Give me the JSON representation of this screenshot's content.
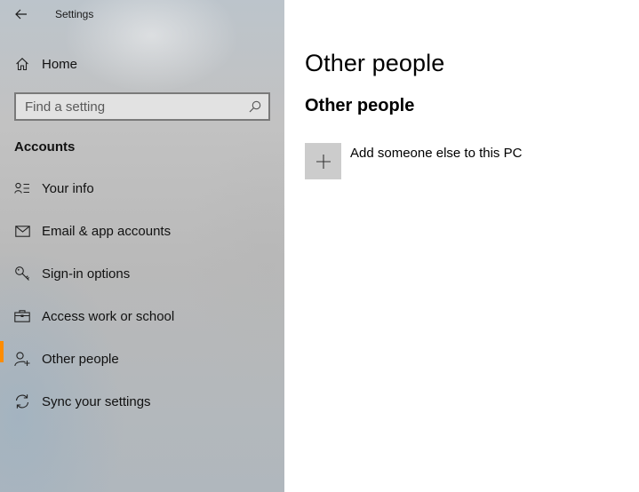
{
  "window": {
    "title": "Settings",
    "back_icon": "back-arrow-icon"
  },
  "sidebar": {
    "home": {
      "label": "Home",
      "icon": "home-icon"
    },
    "search": {
      "placeholder": "Find a setting",
      "value": "",
      "icon": "search-icon"
    },
    "section_heading": "Accounts",
    "items": [
      {
        "label": "Your info",
        "icon": "contact-card-icon",
        "selected": false
      },
      {
        "label": "Email & app accounts",
        "icon": "mail-icon",
        "selected": false
      },
      {
        "label": "Sign-in options",
        "icon": "key-icon",
        "selected": false
      },
      {
        "label": "Access work or school",
        "icon": "briefcase-icon",
        "selected": false
      },
      {
        "label": "Other people",
        "icon": "add-person-icon",
        "selected": true
      },
      {
        "label": "Sync your settings",
        "icon": "sync-icon",
        "selected": false
      }
    ]
  },
  "main": {
    "page_title": "Other people",
    "section_title": "Other people",
    "add_button": {
      "label": "Add someone else to this PC",
      "icon": "plus-icon"
    }
  },
  "colors": {
    "accent": "#ff8c00",
    "content_bg": "#ffffff",
    "tile_bg": "#cccccc"
  }
}
